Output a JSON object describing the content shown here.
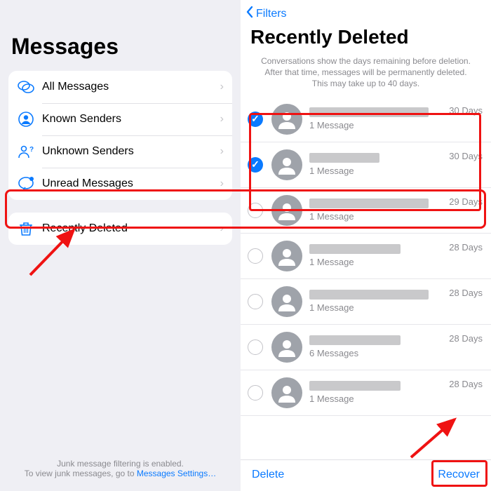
{
  "left": {
    "title": "Messages",
    "items": [
      {
        "label": "All Messages"
      },
      {
        "label": "Known Senders"
      },
      {
        "label": "Unknown Senders"
      },
      {
        "label": "Unread Messages"
      }
    ],
    "recently_deleted_label": "Recently Deleted",
    "footer_line1": "Junk message filtering is enabled.",
    "footer_line2_a": "To view junk messages, go to ",
    "footer_link": "Messages Settings…"
  },
  "right": {
    "back_label": "Filters",
    "title": "Recently Deleted",
    "info": "Conversations show the days remaining before deletion. After that time, messages will be permanently deleted. This may take up to 40 days.",
    "items": [
      {
        "checked": true,
        "nb": "nb-long",
        "sub": "1 Message",
        "days": "30 Days"
      },
      {
        "checked": true,
        "nb": "nb-short",
        "sub": "1 Message",
        "days": "30 Days"
      },
      {
        "checked": false,
        "nb": "nb-long",
        "sub": "1 Message",
        "days": "29 Days"
      },
      {
        "checked": false,
        "nb": "nb-med",
        "sub": "1 Message",
        "days": "28 Days"
      },
      {
        "checked": false,
        "nb": "nb-long",
        "sub": "1 Message",
        "days": "28 Days"
      },
      {
        "checked": false,
        "nb": "nb-med",
        "sub": "6 Messages",
        "days": "28 Days"
      },
      {
        "checked": false,
        "nb": "nb-med",
        "sub": "1 Message",
        "days": "28 Days"
      }
    ],
    "delete_label": "Delete",
    "recover_label": "Recover"
  }
}
